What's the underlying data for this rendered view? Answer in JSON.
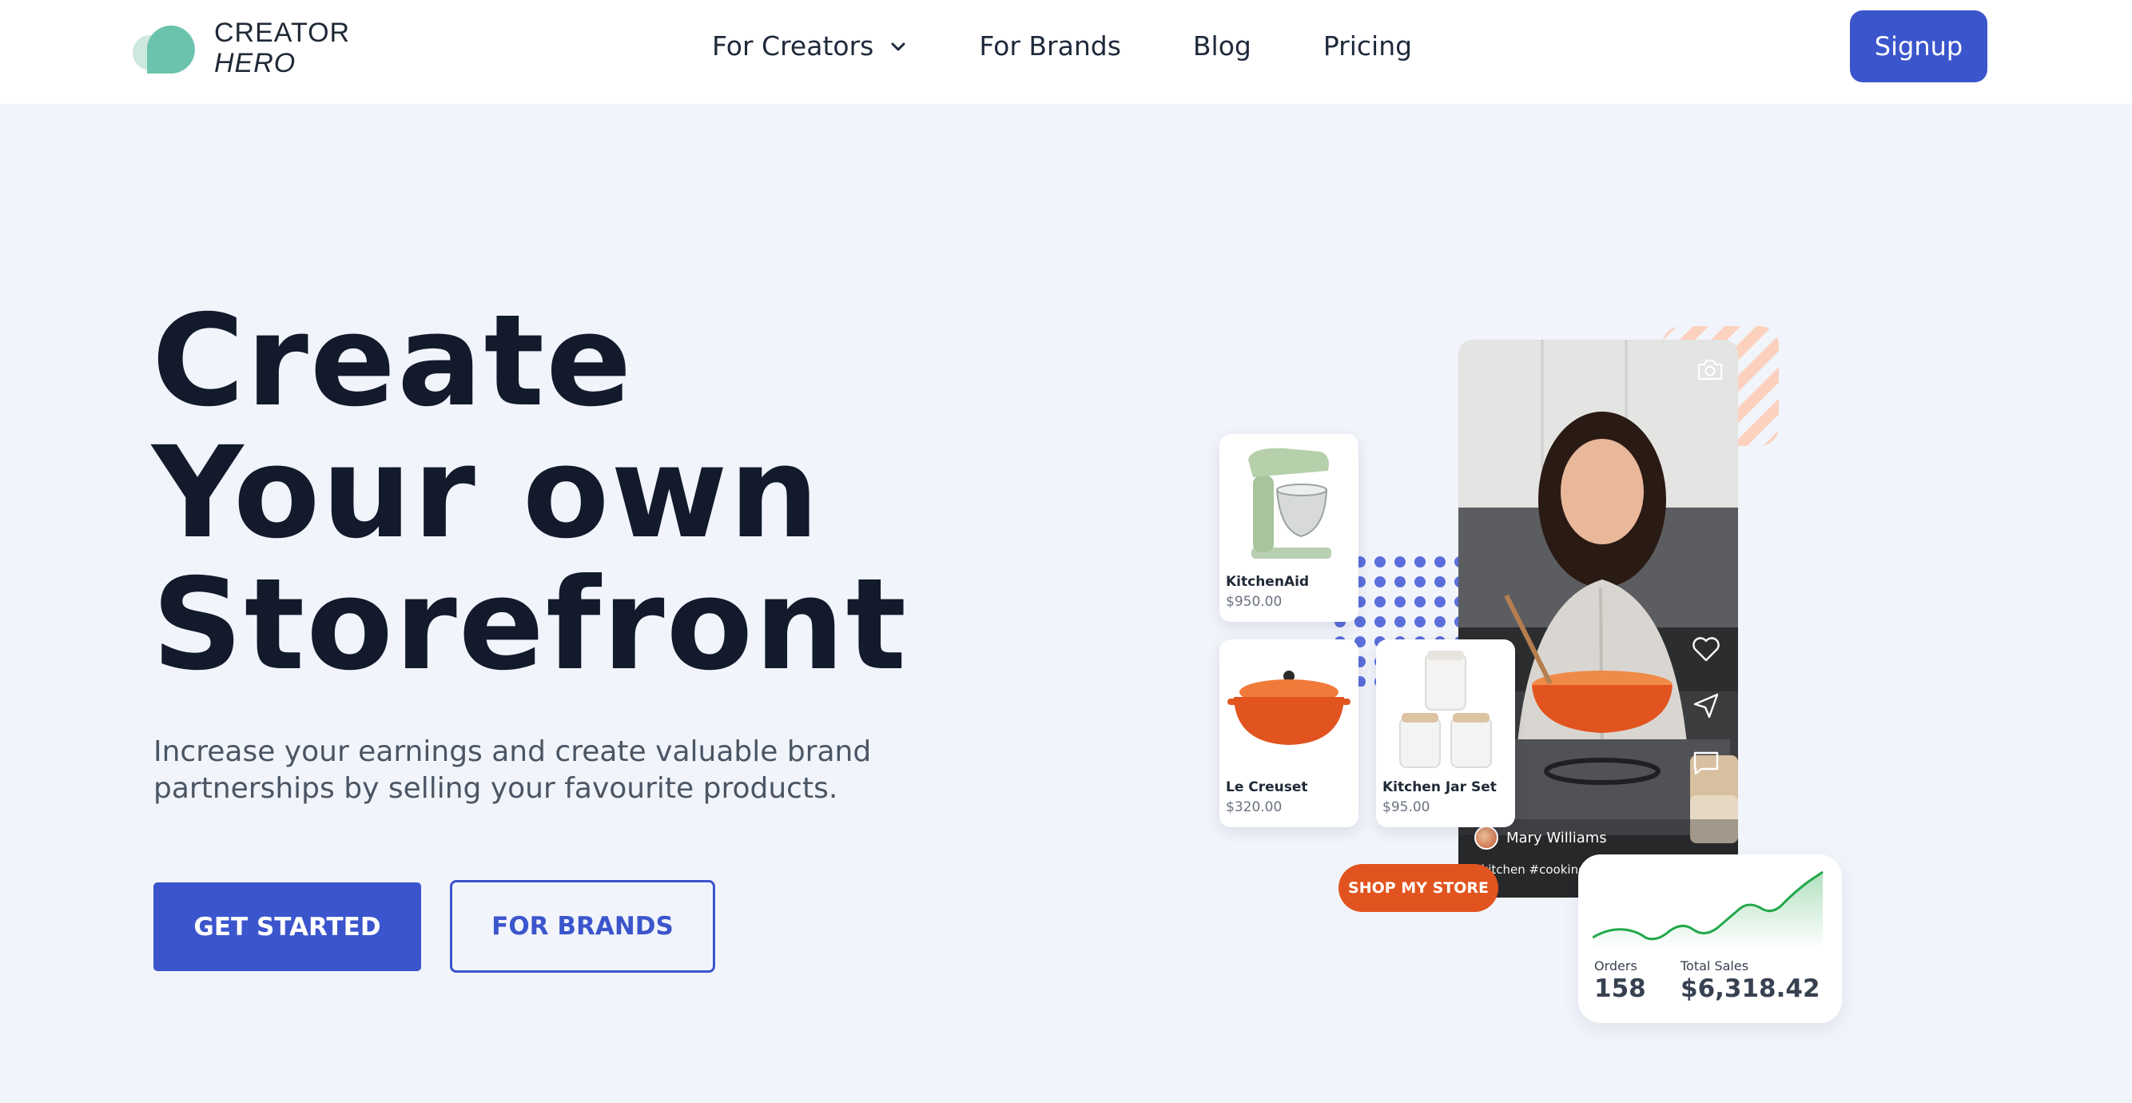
{
  "brand": {
    "line1": "CREATOR",
    "line2": "HERO"
  },
  "nav": {
    "links": [
      {
        "label": "For Creators"
      },
      {
        "label": "For Brands"
      },
      {
        "label": "Blog"
      },
      {
        "label": "Pricing"
      }
    ],
    "signup_label": "Signup"
  },
  "hero": {
    "title_lines": [
      "Create",
      "Your own",
      "Storefront"
    ],
    "subtitle": "Increase your earnings and create valuable brand partnerships by selling your favourite products.",
    "primary_cta": "GET STARTED",
    "secondary_cta": "FOR BRANDS"
  },
  "illustration": {
    "creator_name": "Mary Williams",
    "hashtags": "#kitchen #cooking #shopmystore #healthy",
    "shop_button": "SHOP MY STORE",
    "products": [
      {
        "name": "KitchenAid",
        "price": "$950.00"
      },
      {
        "name": "Le Creuset",
        "price": "$320.00"
      },
      {
        "name": "Kitchen Jar Set",
        "price": "$95.00"
      }
    ],
    "stats": {
      "orders_label": "Orders",
      "orders_value": "158",
      "sales_label": "Total Sales",
      "sales_value": "$6,318.42"
    }
  },
  "colors": {
    "accent": "#3b55cc",
    "orange": "#e2541f",
    "page_bg": "#f1f4fb",
    "chart_green": "#22a84a"
  }
}
